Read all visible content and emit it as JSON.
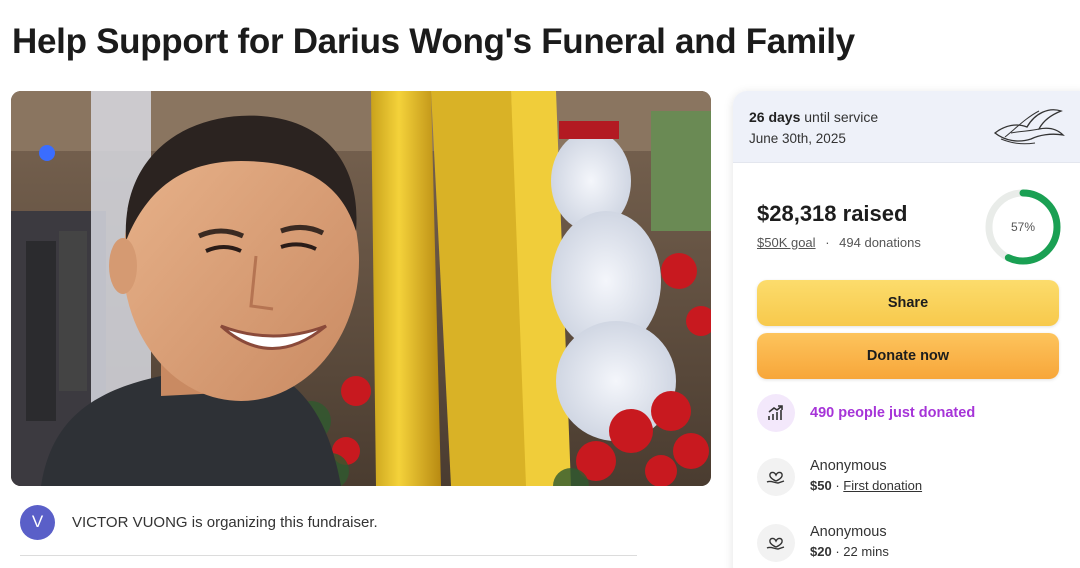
{
  "page": {
    "title": "Help Support for Darius Wong's Funeral and Family"
  },
  "hero": {
    "image": "smiling man in dark jacket posing in front of yellow ribbon sculpture, snowman decoration and red poinsettias"
  },
  "organizer": {
    "initial": "V",
    "text": "VICTOR VUONG is organizing this fundraiser."
  },
  "service": {
    "days": "26 days",
    "days_suffix": "until service",
    "date": "June 30th, 2025",
    "icon": "dove-icon"
  },
  "progress": {
    "raised": "$28,318 raised",
    "goal": "$50K goal",
    "separator": "·",
    "donations": "494 donations",
    "percent_label": "57%",
    "percent_value": 0.57,
    "ring_color": "#1aa053"
  },
  "buttons": {
    "share": "Share",
    "donate": "Donate now"
  },
  "activity": {
    "just_donated": "490 people just donated",
    "icon": "trending-up-icon",
    "accent": "#a634d8"
  },
  "donations": [
    {
      "name": "Anonymous",
      "amount": "$50",
      "separator": "·",
      "note": "First donation",
      "note_underlined": true
    },
    {
      "name": "Anonymous",
      "amount": "$20",
      "separator": "·",
      "note": "22 mins",
      "note_underlined": false
    }
  ],
  "colors": {
    "share_button": "#f9d25a",
    "donate_button": "#f8b448",
    "avatar": "#5a5fc8",
    "card_header": "#eef1f9"
  }
}
